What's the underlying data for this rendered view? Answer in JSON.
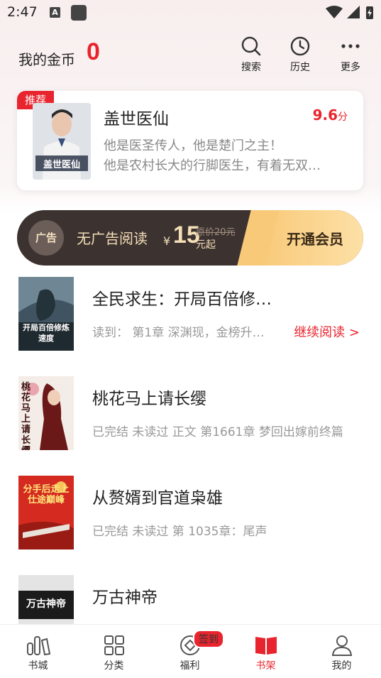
{
  "status": {
    "time": "2:47",
    "a_icon": "A"
  },
  "header": {
    "coins_label": "我的金币",
    "coins_value": "0",
    "search_label": "搜索",
    "history_label": "历史",
    "more_label": "更多"
  },
  "recommend": {
    "badge": "推荐",
    "title": "盖世医仙",
    "score": "9.6",
    "score_unit": "分",
    "desc_line1": "他是医圣传人，他是楚门之主！",
    "desc_line2": "他是农村长大的行脚医生，有着无双…",
    "cover_text": "盖世医仙"
  },
  "vip": {
    "icon_text": "广告",
    "label": "无广告阅读",
    "yen": "¥",
    "price": "15",
    "original": "原价20元",
    "start": "元起",
    "button": "开通会员"
  },
  "books": [
    {
      "title": "全民求生：开局百倍修…",
      "meta": "读到：  第1章 深渊现，金榜升…",
      "continue": "继续阅读 >",
      "cover_text": "开局百倍修炼速度"
    },
    {
      "title": "桃花马上请长缨",
      "meta": "已完结 未读过 正文 第1661章 梦回出嫁前终篇",
      "cover_text": "桃花马上请长缨"
    },
    {
      "title": "从赘婿到官道枭雄",
      "meta": "已完结 未读过 第 1035章：尾声",
      "cover_text": "分手后走上仕途巅峰"
    },
    {
      "title": "万古神帝",
      "meta": "",
      "cover_text": "万古神帝"
    }
  ],
  "tabs": [
    {
      "label": "书城"
    },
    {
      "label": "分类"
    },
    {
      "label": "福利",
      "badge": "签到"
    },
    {
      "label": "书架"
    },
    {
      "label": "我的"
    }
  ],
  "colors": {
    "accent": "#e8252e",
    "vip_dark": "#3c3230",
    "vip_gold": "#f8c978"
  }
}
